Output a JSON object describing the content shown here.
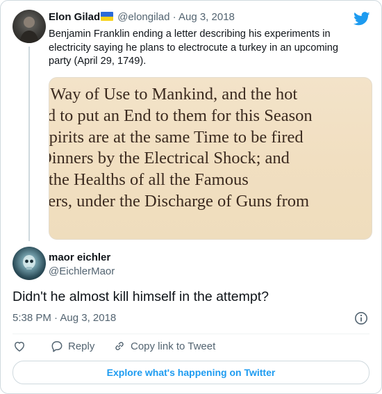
{
  "parent_tweet": {
    "author_name": "Elon Gilad",
    "flag_icon": "ukraine-flag-icon",
    "handle": "@elongilad",
    "separator": "·",
    "date": "Aug 3, 2018",
    "text": "Benjamin Franklin ending a letter describing his experiments in electricity saying he plans to electrocute a turkey in an upcoming party (April 29, 1749).",
    "media_lines": [
      "s Way of Use to Mankind, and the hot",
      "ed to put an End to them for this Season",
      "Spirits are at the same Time to be fired",
      "Dinners by the Electrical Shock; and",
      "ı the Healths of all the Famous",
      "pers, under the Discharge of Guns from"
    ]
  },
  "reply_tweet": {
    "author_name": "maor eichler",
    "handle": "@EichlerMaor",
    "text": "Didn't he almost kill himself in the attempt?",
    "time": "5:38 PM · Aug 3, 2018"
  },
  "actions": {
    "like_icon": "heart-icon",
    "reply_icon": "speech-bubble-icon",
    "reply_label": "Reply",
    "copy_icon": "link-icon",
    "copy_label": "Copy link to Tweet"
  },
  "explore_button": "Explore what's happening on Twitter",
  "colors": {
    "brand": "#1d9bf0",
    "text": "#0f1419",
    "secondary": "#536471",
    "border": "#cfd9de"
  }
}
